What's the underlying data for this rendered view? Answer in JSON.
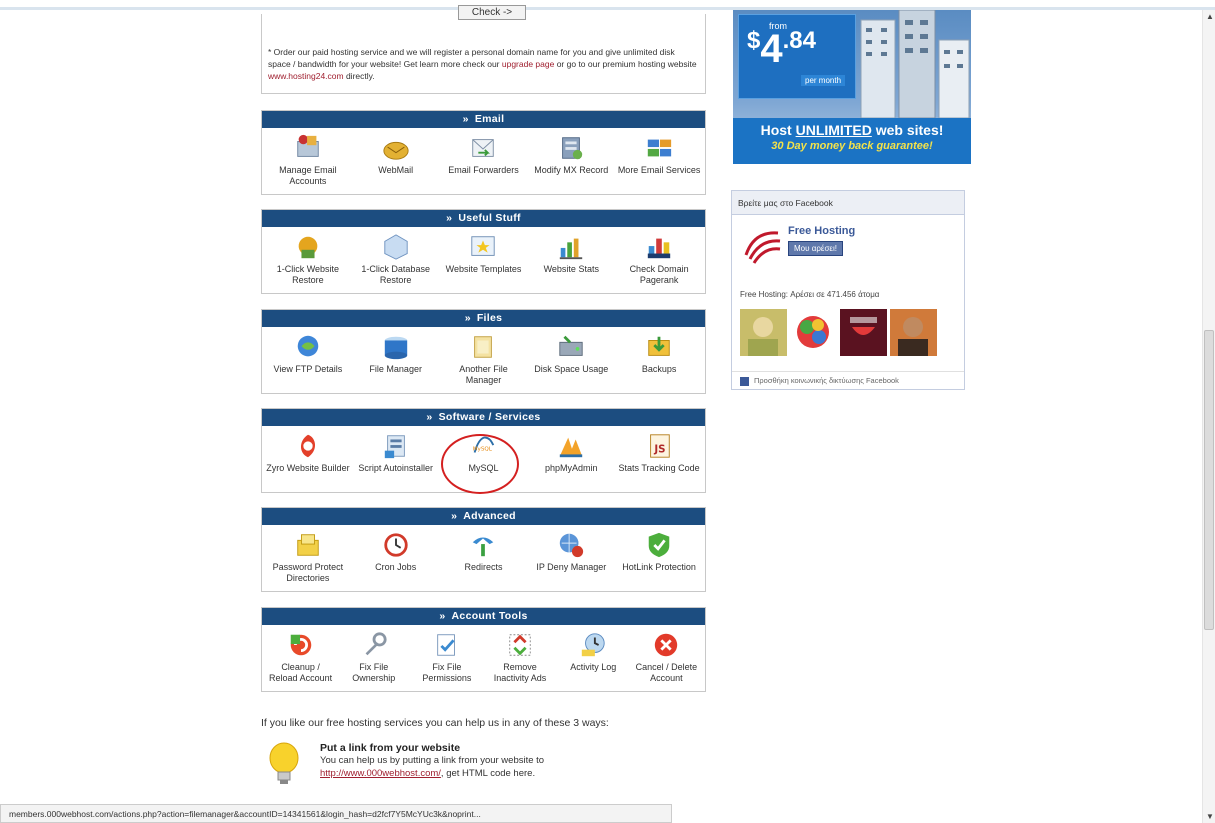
{
  "check_button": {
    "label": "Check ->"
  },
  "notice": {
    "text_1": "* Order our paid hosting service and we will register a personal domain name for you and give unlimited disk space / bandwidth for your website! Get learn more check our ",
    "upgrade_link": "upgrade page",
    "text_2": " or go to our premium hosting website ",
    "site_link": "www.hosting24.com",
    "text_3": " directly."
  },
  "sections": [
    {
      "title": "Email",
      "items": [
        {
          "icon": "manage-email-icon",
          "label": "Manage Email Accounts"
        },
        {
          "icon": "webmail-icon",
          "label": "WebMail"
        },
        {
          "icon": "email-forwarders-icon",
          "label": "Email Forwarders"
        },
        {
          "icon": "modify-mx-icon",
          "label": "Modify MX Record"
        },
        {
          "icon": "more-email-icon",
          "label": "More Email Services"
        }
      ]
    },
    {
      "title": "Useful Stuff",
      "items": [
        {
          "icon": "website-restore-icon",
          "label": "1-Click Website Restore"
        },
        {
          "icon": "database-restore-icon",
          "label": "1-Click Database Restore"
        },
        {
          "icon": "website-templates-icon",
          "label": "Website Templates"
        },
        {
          "icon": "website-stats-icon",
          "label": "Website Stats"
        },
        {
          "icon": "pagerank-icon",
          "label": "Check Domain Pagerank"
        }
      ]
    },
    {
      "title": "Files",
      "items": [
        {
          "icon": "ftp-icon",
          "label": "View FTP Details"
        },
        {
          "icon": "file-manager-icon",
          "label": "File Manager"
        },
        {
          "icon": "another-file-manager-icon",
          "label": "Another File Manager"
        },
        {
          "icon": "disk-space-icon",
          "label": "Disk Space Usage"
        },
        {
          "icon": "backups-icon",
          "label": "Backups"
        }
      ]
    },
    {
      "title": "Software / Services",
      "items": [
        {
          "icon": "zyro-icon",
          "label": "Zyro Website Builder"
        },
        {
          "icon": "autoinstaller-icon",
          "label": "Script Autoinstaller"
        },
        {
          "icon": "mysql-icon",
          "label": "MySQL"
        },
        {
          "icon": "phpmyadmin-icon",
          "label": "phpMyAdmin"
        },
        {
          "icon": "stats-tracking-icon",
          "label": "Stats Tracking Code"
        }
      ]
    },
    {
      "title": "Advanced",
      "items": [
        {
          "icon": "password-protect-icon",
          "label": "Password Protect Directories"
        },
        {
          "icon": "cron-jobs-icon",
          "label": "Cron Jobs"
        },
        {
          "icon": "redirects-icon",
          "label": "Redirects"
        },
        {
          "icon": "ip-deny-icon",
          "label": "IP Deny Manager"
        },
        {
          "icon": "hotlink-icon",
          "label": "HotLink Protection"
        }
      ]
    },
    {
      "title": "Account Tools",
      "items": [
        {
          "icon": "cleanup-reload-icon",
          "label": "Cleanup / Reload Account"
        },
        {
          "icon": "fix-ownership-icon",
          "label": "Fix File Ownership"
        },
        {
          "icon": "fix-permissions-icon",
          "label": "Fix File Permissions"
        },
        {
          "icon": "remove-inactivity-icon",
          "label": "Remove Inactivity Ads"
        },
        {
          "icon": "activity-log-icon",
          "label": "Activity Log"
        },
        {
          "icon": "cancel-account-icon",
          "label": "Cancel / Delete Account"
        }
      ]
    }
  ],
  "help": {
    "intro": "If you like our free hosting services you can help us in any of these 3 ways:",
    "item_title": "Put a link from your website",
    "item_desc": "You can help us by putting a link from your website to",
    "item_url": "http://www.000webhost.com/",
    "item_desc_2": ", get HTML code here."
  },
  "ad": {
    "from": "from",
    "dollar": "$",
    "amount": "4",
    "cents": ".84",
    "per": "per month",
    "line1_a": "Host ",
    "line1_u": "UNLIMITED",
    "line1_b": " web sites!",
    "line2": "30 Day money back guarantee!"
  },
  "facebook": {
    "header": "Βρείτε μας στο Facebook",
    "page_name": "Free Hosting",
    "like_label": "Μου αρέσει!",
    "count_text": "Free Hosting: Αρέσει σε 471.456 άτομα",
    "footer": "Προσθήκη κοινωνικής δικτύωσης Facebook"
  },
  "statusbar": {
    "url": "members.000webhost.com/actions.php?action=filemanager&accountID=14341561&login_hash=d2fcf7Y5McYUc3k&noprint..."
  },
  "colors": {
    "section_header": "#1c4d80",
    "mysql_circle": "#d42020",
    "ad_blue": "#1b73c4"
  }
}
